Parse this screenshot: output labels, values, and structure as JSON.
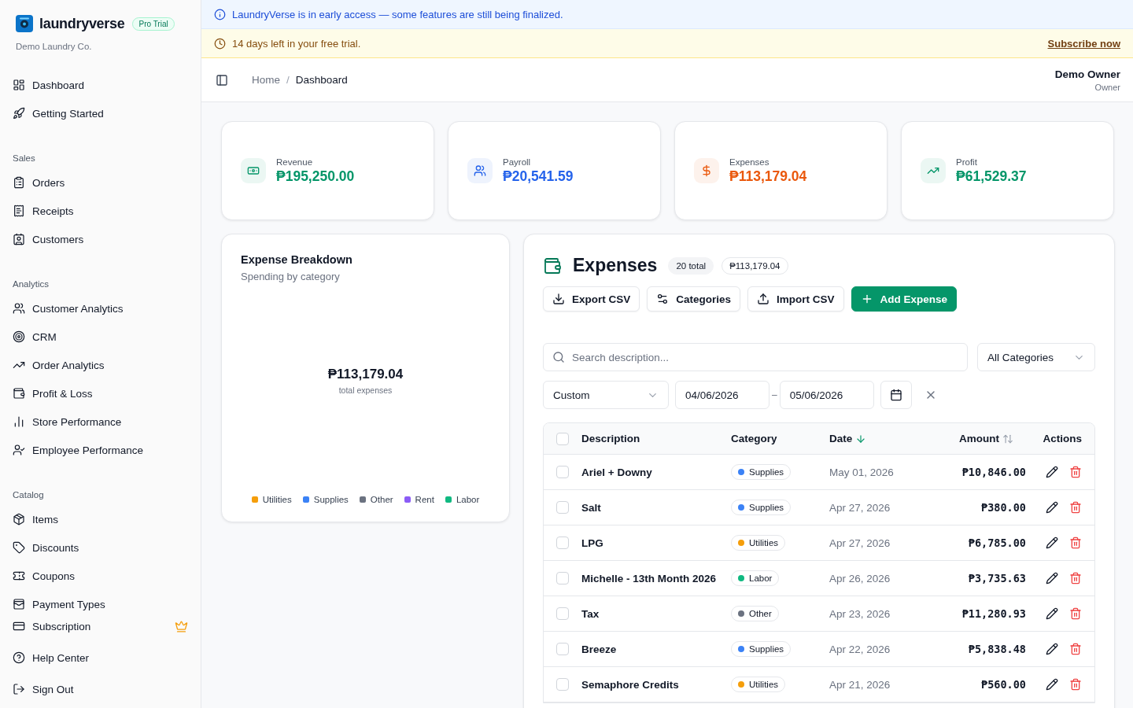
{
  "brand": {
    "name": "laundryverse",
    "badge": "Pro Trial",
    "company": "Demo Laundry Co."
  },
  "nav": [
    {
      "items": [
        {
          "label": "Dashboard",
          "selected": false
        },
        {
          "label": "Getting Started",
          "selected": false
        }
      ]
    },
    {
      "title": "Sales",
      "items": [
        {
          "label": "Orders",
          "selected": false
        },
        {
          "label": "Receipts",
          "selected": false
        },
        {
          "label": "Customers",
          "selected": false
        }
      ]
    },
    {
      "title": "Analytics",
      "items": [
        {
          "label": "Customer Analytics",
          "selected": false
        },
        {
          "label": "CRM",
          "selected": false
        },
        {
          "label": "Order Analytics",
          "selected": false
        },
        {
          "label": "Profit & Loss",
          "selected": false
        },
        {
          "label": "Store Performance",
          "selected": false
        },
        {
          "label": "Employee Performance",
          "selected": false
        }
      ]
    },
    {
      "title": "Catalog",
      "items": [
        {
          "label": "Items",
          "selected": false
        },
        {
          "label": "Discounts",
          "selected": false
        },
        {
          "label": "Coupons",
          "selected": false
        },
        {
          "label": "Payment Types",
          "selected": false
        }
      ]
    }
  ],
  "footer_nav": [
    {
      "label": "Subscription",
      "premium": true
    },
    {
      "label": "Help Center",
      "premium": false
    },
    {
      "label": "Sign Out",
      "premium": false
    }
  ],
  "info_banner": "LaundryVerse is in early access — some features are still being finalized.",
  "trial_banner": {
    "text": "14 days left in your free trial.",
    "link": "Subscribe now"
  },
  "breadcrumb": [
    "Home",
    "Dashboard"
  ],
  "breadcrumb_separator": "/",
  "user": {
    "name": "Demo Owner",
    "role": "Owner"
  },
  "stats": [
    {
      "label": "Revenue",
      "value": "₱195,250.00",
      "color": "#059669"
    },
    {
      "label": "Payroll",
      "value": "₱20,541.59",
      "color": "#2563eb"
    },
    {
      "label": "Expenses",
      "value": "₱113,179.04",
      "color": "#ea580c"
    },
    {
      "label": "Profit",
      "value": "₱61,529.37",
      "color": "#059669"
    }
  ],
  "breakdown": {
    "title": "Expense Breakdown",
    "subtitle": "Spending by category",
    "total": "₱113,179.04",
    "total_label": "total expenses",
    "legend": [
      {
        "label": "Utilities",
        "color": "#f59e0b"
      },
      {
        "label": "Supplies",
        "color": "#3b82f6"
      },
      {
        "label": "Other",
        "color": "#6b7280"
      },
      {
        "label": "Rent",
        "color": "#8b5cf6"
      },
      {
        "label": "Labor",
        "color": "#10b981"
      }
    ]
  },
  "expenses": {
    "title": "Expenses",
    "count": "20 total",
    "sum": "₱113,179.04",
    "buttons": [
      "Export CSV",
      "Categories",
      "Import CSV",
      "Add Expense"
    ],
    "search": {
      "placeholder": "Search description..."
    },
    "category_filter": "All Categories",
    "range": "Custom",
    "date_from": "04/06/2026",
    "date_to": "05/06/2026",
    "date_separator": "–",
    "columns": [
      {
        "label": "Description"
      },
      {
        "label": "Category"
      },
      {
        "label": "Date",
        "sorted": true
      },
      {
        "label": "Amount",
        "sorted": false
      },
      {
        "label": "Actions"
      }
    ],
    "all_checked": false,
    "rows": [
      {
        "checked": false,
        "description": "Ariel + Downy",
        "category": "Supplies",
        "color": "#3b82f6",
        "date": "May 01, 2026",
        "amount": "₱10,846.00"
      },
      {
        "checked": false,
        "description": "Salt",
        "category": "Supplies",
        "color": "#3b82f6",
        "date": "Apr 27, 2026",
        "amount": "₱380.00"
      },
      {
        "checked": false,
        "description": "LPG",
        "category": "Utilities",
        "color": "#f59e0b",
        "date": "Apr 27, 2026",
        "amount": "₱6,785.00"
      },
      {
        "checked": false,
        "description": "Michelle - 13th Month 2026",
        "category": "Labor",
        "color": "#10b981",
        "date": "Apr 26, 2026",
        "amount": "₱3,735.63"
      },
      {
        "checked": false,
        "description": "Tax",
        "category": "Other",
        "color": "#6b7280",
        "date": "Apr 23, 2026",
        "amount": "₱11,280.93"
      },
      {
        "checked": false,
        "description": "Breeze",
        "category": "Supplies",
        "color": "#3b82f6",
        "date": "Apr 22, 2026",
        "amount": "₱5,838.48"
      },
      {
        "checked": false,
        "description": "Semaphore Credits",
        "category": "Utilities",
        "color": "#f59e0b",
        "date": "Apr 21, 2026",
        "amount": "₱560.00"
      }
    ]
  }
}
